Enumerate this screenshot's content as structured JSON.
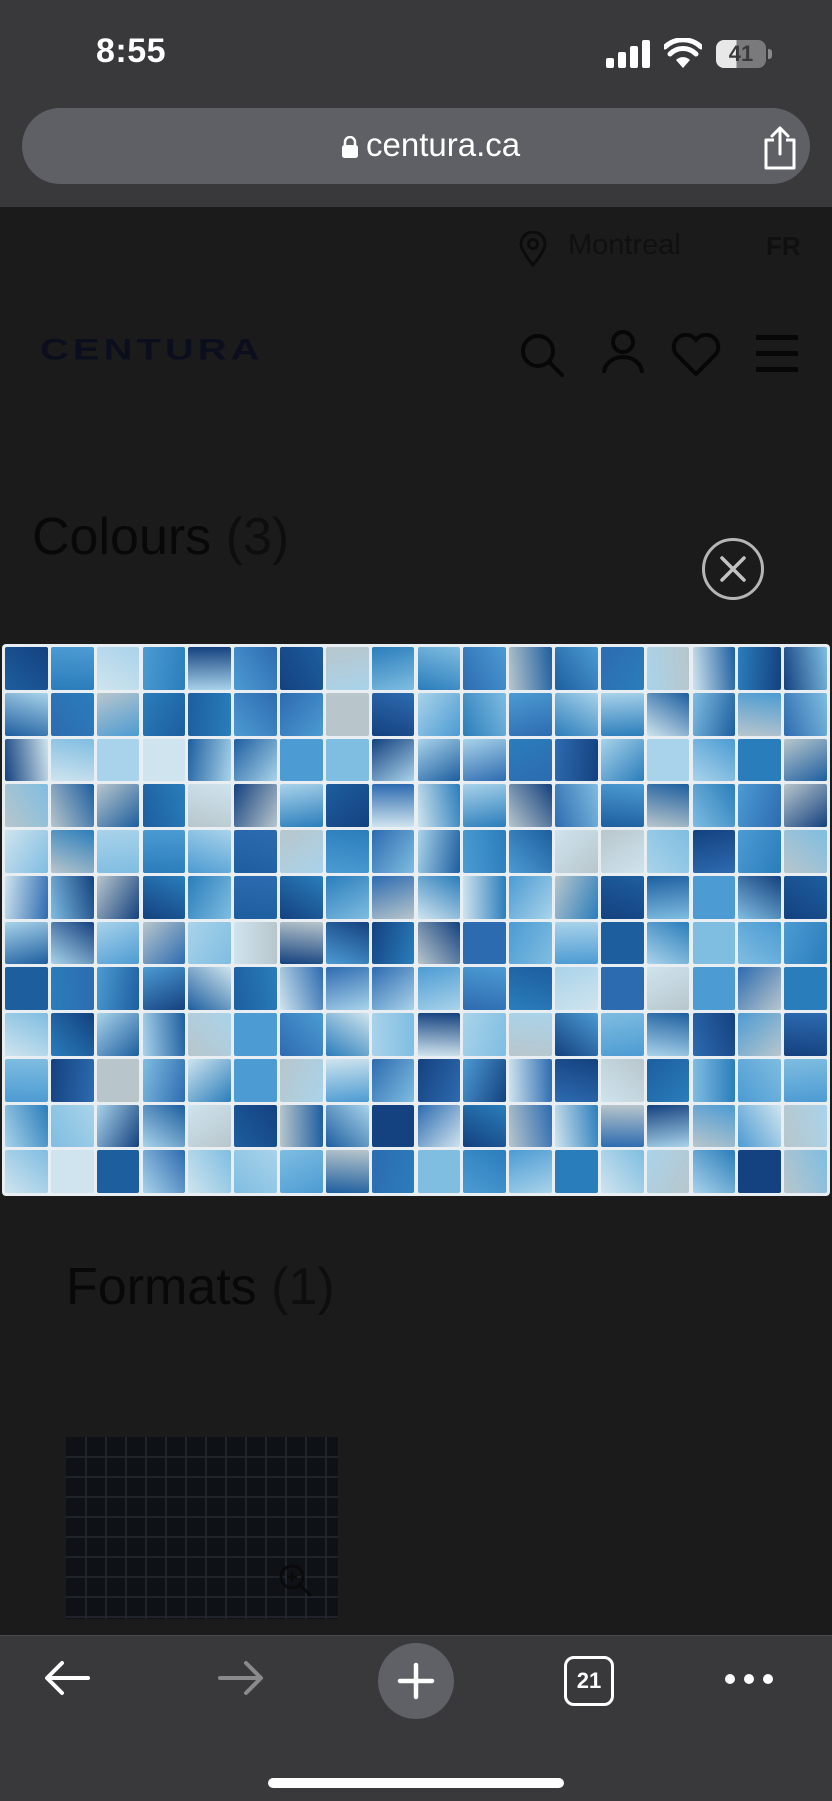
{
  "status_bar": {
    "time": "8:55",
    "battery_level": "41",
    "icons": [
      "signal-icon",
      "wifi-icon",
      "battery-icon"
    ]
  },
  "browser": {
    "url": "centura.ca",
    "url_icon": "lock-icon",
    "share_icon": "share-icon"
  },
  "site_header": {
    "location": "Montreal",
    "language_toggle": "FR",
    "logo_text": "CENTURA",
    "icons": [
      "search-icon",
      "account-icon",
      "heart-icon",
      "menu-icon"
    ]
  },
  "product": {
    "colours_label": "Colours",
    "colours_count": "(3)",
    "formats_label": "Formats",
    "formats_count": "(1)"
  },
  "lightbox": {
    "close_icon": "close-icon",
    "image": "blue-glass-mosaic-tile",
    "zoom_icon": "zoom-in-icon"
  },
  "toolbar": {
    "icons": [
      "back-arrow-icon",
      "forward-arrow-icon",
      "plus-icon",
      "tabs-icon",
      "more-icon"
    ],
    "forward_enabled": false,
    "tab_count": "21"
  },
  "colors": {
    "chrome": "#39393b",
    "url_bar": "#5f6066",
    "page_dim": "#1b1b1b",
    "tile_light": "#a9d3ea",
    "tile_mid": "#2a7dbb",
    "tile_dark": "#14417f"
  }
}
